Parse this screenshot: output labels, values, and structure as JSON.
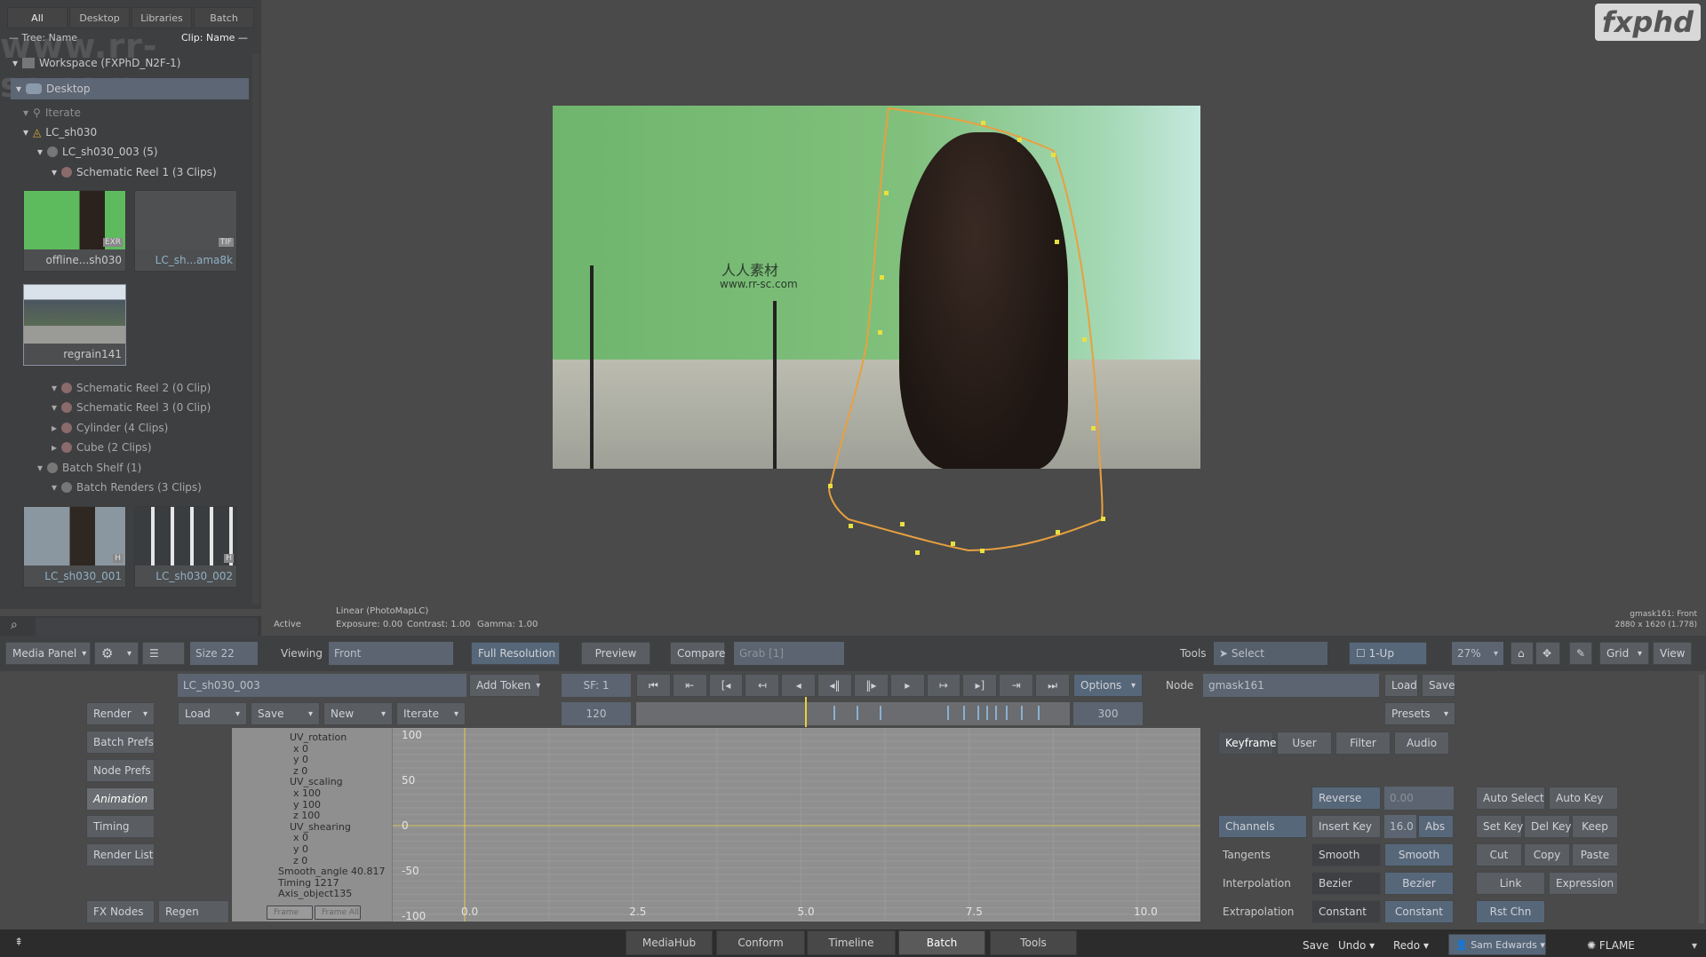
{
  "media_panel": {
    "tabs": [
      "All",
      "Desktop",
      "Libraries",
      "Batch"
    ],
    "tree_header_left": "— Tree: Name",
    "tree_header_right": "Clip: Name —",
    "workspace": "Workspace (FXPhD_N2F-1)",
    "desktop": "Desktop",
    "tree": [
      "Iterate",
      "LC_sh030",
      "LC_sh030_003 (5)",
      "Schematic Reel 1 (3 Clips)",
      "Schematic Reel 2 (0 Clip)",
      "Schematic Reel 3 (0 Clip)",
      "Cylinder (4 Clips)",
      "Cube (2 Clips)",
      "Batch Shelf (1)",
      "Batch Renders (3 Clips)"
    ],
    "clips": [
      {
        "name": "offline...sh030",
        "badge": "EXR"
      },
      {
        "name": "LC_sh...ama8k",
        "badge": "TIF"
      },
      {
        "name": "regrain141",
        "badge": ""
      },
      {
        "name": "LC_sh030_001",
        "badge": "H"
      },
      {
        "name": "LC_sh030_002",
        "badge": "H"
      }
    ]
  },
  "watermark": {
    "logo": "fxphd",
    "site": "www.rr-sc.com",
    "cn": "人人素材"
  },
  "viewer": {
    "status": "Active",
    "colorspace": "Linear (PhotoMapLC)",
    "exposure": "Exposure: 0.00",
    "contrast": "Contrast: 1.00",
    "gamma": "Gamma: 1.00",
    "node_view": "gmask161: Front",
    "resolution": "2880 x 1620 (1.778)"
  },
  "toolbar": {
    "media_panel": "Media Panel",
    "size": "Size 22",
    "viewing_label": "Viewing",
    "viewing_value": "Front",
    "full_resolution": "Full Resolution",
    "preview": "Preview",
    "compare": "Compare",
    "grab": "Grab [1]",
    "tools_label": "Tools",
    "select": "Select",
    "layout": "1-Up",
    "zoom": "27%",
    "grid": "Grid",
    "view": "View"
  },
  "batch": {
    "name": "LC_sh030_003",
    "add_token": "Add Token",
    "render": "Render",
    "load": "Load",
    "save": "Save",
    "new": "New",
    "iterate": "Iterate",
    "side_buttons": [
      "Batch Prefs",
      "Node Prefs",
      "Animation",
      "Timing",
      "Render List"
    ],
    "fx_nodes": "FX Nodes",
    "regen": "Regen"
  },
  "transport": {
    "sf": "SF: 1",
    "start": "120",
    "end": "300",
    "options": "Options"
  },
  "node": {
    "label": "Node",
    "value": "gmask161",
    "load": "Load",
    "save": "Save",
    "presets": "Presets"
  },
  "channels": [
    "UV_rotation",
    "x 0",
    "y 0",
    "z 0",
    "UV_scaling",
    "x 100",
    "y 100",
    "z 100",
    "UV_shearing",
    "x 0",
    "y 0",
    "z 0",
    "Smooth_angle 40.817",
    "Timing 1217",
    "Axis_object135"
  ],
  "channel_buttons": {
    "frame": "Frame",
    "frame_all": "Frame All"
  },
  "graph": {
    "y_ticks": [
      "100",
      "50",
      "0",
      "-50",
      "-100"
    ],
    "x_ticks": [
      "0.0",
      "2.5",
      "5.0",
      "7.5",
      "10.0"
    ]
  },
  "keyframe": {
    "tabs": [
      "Keyframe",
      "User",
      "Filter",
      "Audio"
    ],
    "reverse": "Reverse",
    "reverse_value": "0.00",
    "channels": "Channels",
    "insert_key": "Insert Key",
    "insert_value": "16.0",
    "abs": "Abs",
    "tangents": "Tangents",
    "tangents_value": "Smooth",
    "tangents_button": "Smooth",
    "interpolation": "Interpolation",
    "interpolation_value": "Bezier",
    "interpolation_button": "Bezier",
    "extrapolation": "Extrapolation",
    "extrapolation_value": "Constant",
    "extrapolation_button": "Constant",
    "auto_select": "Auto Select",
    "auto_key": "Auto Key",
    "set_key": "Set Key",
    "del_key": "Del Key",
    "keep": "Keep",
    "cut": "Cut",
    "copy": "Copy",
    "paste": "Paste",
    "link": "Link",
    "expression": "Expression",
    "rst_chn": "Rst Chn"
  },
  "bottom": {
    "tabs": [
      "MediaHub",
      "Conform",
      "Timeline",
      "Batch",
      "Tools"
    ],
    "active_tab": "Batch",
    "save": "Save",
    "undo": "Undo",
    "redo": "Redo",
    "user": "Sam Edwards",
    "app": "FLAME"
  },
  "colors": {
    "mask": "#e8c84a",
    "accent": "#57677a",
    "graph_bg": "#8f8f8f"
  }
}
